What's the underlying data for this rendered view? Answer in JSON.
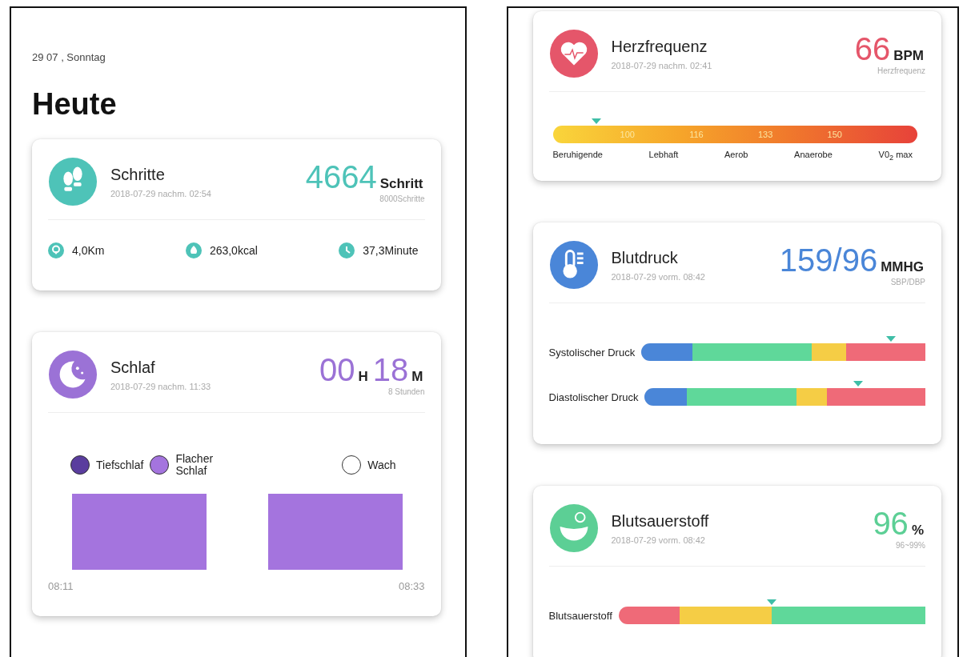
{
  "left": {
    "date": "29 07 , Sonntag",
    "title": "Heute",
    "steps": {
      "kind": "steps",
      "color": "#4ec3b8",
      "title": "Schritte",
      "time": "2018-07-29 nachm. 02:54",
      "value_parts": [
        {
          "number": "4664",
          "unit": "Schritt"
        }
      ],
      "caption": "8000Schritte",
      "stats": [
        {
          "kind": "distance",
          "text": "4,0Km"
        },
        {
          "kind": "calories",
          "text": "263,0kcal"
        },
        {
          "kind": "duration",
          "text": "37,3Minute"
        }
      ]
    },
    "sleep": {
      "kind": "sleep",
      "color": "#9b72d6",
      "title": "Schlaf",
      "time": "2018-07-29 nachm. 11:33",
      "value_parts": [
        {
          "number": "00",
          "unit": "H"
        },
        {
          "number": "18",
          "unit": "M"
        }
      ],
      "caption": "8 Stunden",
      "legend": [
        {
          "label": "Tiefschlaf",
          "color": "#5a3d9e"
        },
        {
          "label": "Flacher Schlaf",
          "color": "#a474de"
        },
        {
          "label": "Wach",
          "color": "#ffffff"
        }
      ],
      "times": [
        "08:11",
        "08:33"
      ]
    }
  },
  "right": {
    "heart": {
      "kind": "heart",
      "color": "#e5566a",
      "title": "Herzfrequenz",
      "time": "2018-07-29 nachm. 02:41",
      "value_parts": [
        {
          "number": "66",
          "unit": "BPM"
        }
      ],
      "caption": "Herzfrequenz",
      "gauge": {
        "level": 0.12,
        "ticks": [
          "100",
          "116",
          "133",
          "150"
        ],
        "zones": [
          "Beruhigende",
          "Lebhaft",
          "Aerob",
          "Anaerobe",
          "V0$_{2}$ max"
        ]
      }
    },
    "pressure": {
      "kind": "pressure",
      "color": "#4a86d8",
      "title": "Blutdruck",
      "time": "2018-07-29 vorm. 08:42",
      "value_parts": [
        {
          "number": "159/96",
          "unit": "MMHG"
        }
      ],
      "caption": "SBP/DBP",
      "rows": [
        {
          "label": "Systolischer Druck",
          "level": 0.88,
          "segments": [
            {
              "color": "#4a86d8"
            },
            {
              "color": "#5fd89a"
            },
            {
              "color": "#f5cd45"
            },
            {
              "color": "#ef6a78"
            }
          ]
        },
        {
          "label": "Diastolischer Druck",
          "level": 0.76,
          "segments": [
            {
              "color": "#4a86d8"
            },
            {
              "color": "#5fd89a"
            },
            {
              "color": "#f5cd45"
            },
            {
              "color": "#ef6a78"
            }
          ]
        }
      ]
    },
    "oxygen": {
      "kind": "oxygen",
      "color": "#5ccf95",
      "title": "Blutsauerstoff",
      "time": "2018-07-29 vorm. 08:42",
      "value_parts": [
        {
          "number": "96",
          "unit": "%"
        }
      ],
      "caption": "96~99%",
      "rows": [
        {
          "label": "Blutsauerstoff",
          "level": 0.5,
          "segments": [
            {
              "color": "#ef6a78"
            },
            {
              "color": "#f5cd45"
            },
            {
              "color": "#5fd89a"
            }
          ]
        }
      ]
    }
  }
}
